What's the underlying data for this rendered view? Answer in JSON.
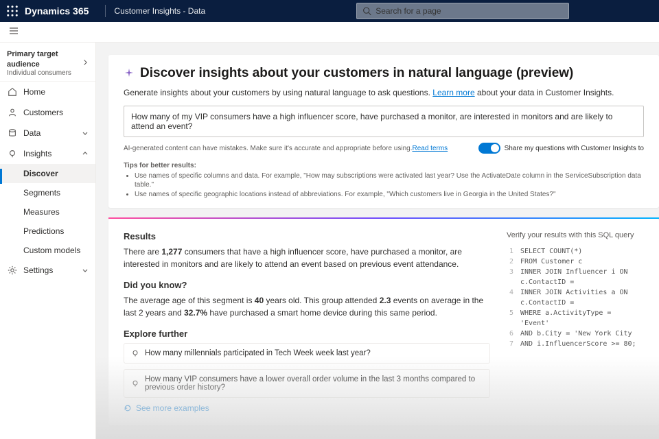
{
  "topbar": {
    "brand": "Dynamics 365",
    "product": "Customer Insights - Data",
    "search_placeholder": "Search for a page"
  },
  "sidebar": {
    "audience_label": "Primary target audience",
    "audience_value": "Individual consumers",
    "items": [
      {
        "label": "Home",
        "icon": "home"
      },
      {
        "label": "Customers",
        "icon": "customers"
      },
      {
        "label": "Data",
        "icon": "data",
        "expandable": true
      },
      {
        "label": "Insights",
        "icon": "insights",
        "expanded": true,
        "children": [
          {
            "label": "Discover",
            "active": true
          },
          {
            "label": "Segments"
          },
          {
            "label": "Measures"
          },
          {
            "label": "Predictions"
          },
          {
            "label": "Custom models"
          }
        ]
      },
      {
        "label": "Settings",
        "icon": "settings",
        "expandable": true
      }
    ]
  },
  "header": {
    "title": "Discover insights about your customers in natural language (preview)",
    "intro_prefix": "Generate insights about your customers by using natural language to ask questions. ",
    "learn_more": "Learn more",
    "intro_suffix": " about your data in Customer Insights."
  },
  "query": {
    "value": "How many of my VIP consumers have a high influencer score, have purchased a monitor, are interested in monitors and are likely to attend an event?"
  },
  "disclaimer": {
    "text_prefix": "AI-generated content can have mistakes. Make sure it's accurate and appropriate before using. ",
    "read_terms": "Read terms",
    "share_label": "Share my questions with Customer Insights to",
    "share_on": true
  },
  "tips": {
    "title": "Tips for better results:",
    "items": [
      "Use names of specific columns and data. For example, \"How may subscriptions were activated last year? Use the ActivateDate column in the ServiceSubscription data table.\"",
      "Use names of specific geographic locations instead of abbreviations. For example, \"Which customers live in Georgia in the United States?\""
    ]
  },
  "results": {
    "heading": "Results",
    "text1_a": "There are ",
    "count": "1,277",
    "text1_b": " consumers that have a high influencer score, have purchased a monitor, are interested in monitors and are likely to attend an event based on previous event attendance.",
    "dyk": "Did you know?",
    "text2_a": "The average age of this segment is ",
    "age": "40",
    "text2_b": " years old. This group attended ",
    "events": "2.3",
    "text2_c": " events on average in the last 2 years and ",
    "pct": "32.7%",
    "text2_d": " have purchased a smart home device during this same period.",
    "explore": "Explore further",
    "suggestions": [
      "How many millennials participated in Tech Week week last year?",
      "How many VIP consumers have a lower overall order volume in the last 3 months compared to previous order history?"
    ],
    "see_more": "See more examples"
  },
  "sql": {
    "verify_label": "Verify your results with this SQL query",
    "lines": [
      "SELECT COUNT(*)",
      "FROM Customer c",
      "INNER JOIN Influencer i ON c.ContactID =",
      "INNER JOIN Activities a ON c.ContactID =",
      "WHERE a.ActivityType = 'Event'",
      "AND b.City = 'New York City",
      "AND i.InfluencerScore >= 80;"
    ]
  }
}
